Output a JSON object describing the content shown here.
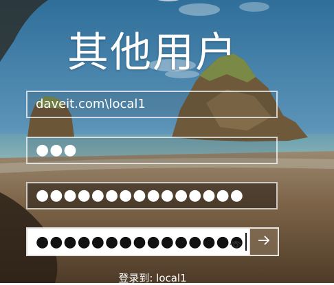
{
  "title": "其他用户",
  "username_field": {
    "value": "daveit.com\\local1"
  },
  "pin_field": {
    "masked_value": "●●●"
  },
  "password_field": {
    "masked_value": "●●●●●●●●●●●●●●●"
  },
  "confirm_password_field": {
    "masked_value": "●●●●●●●●●●●●●●●"
  },
  "reveal_icon": "eye-icon",
  "submit_icon": "arrow-right-icon",
  "signin_to_text": "登录到: local1"
}
